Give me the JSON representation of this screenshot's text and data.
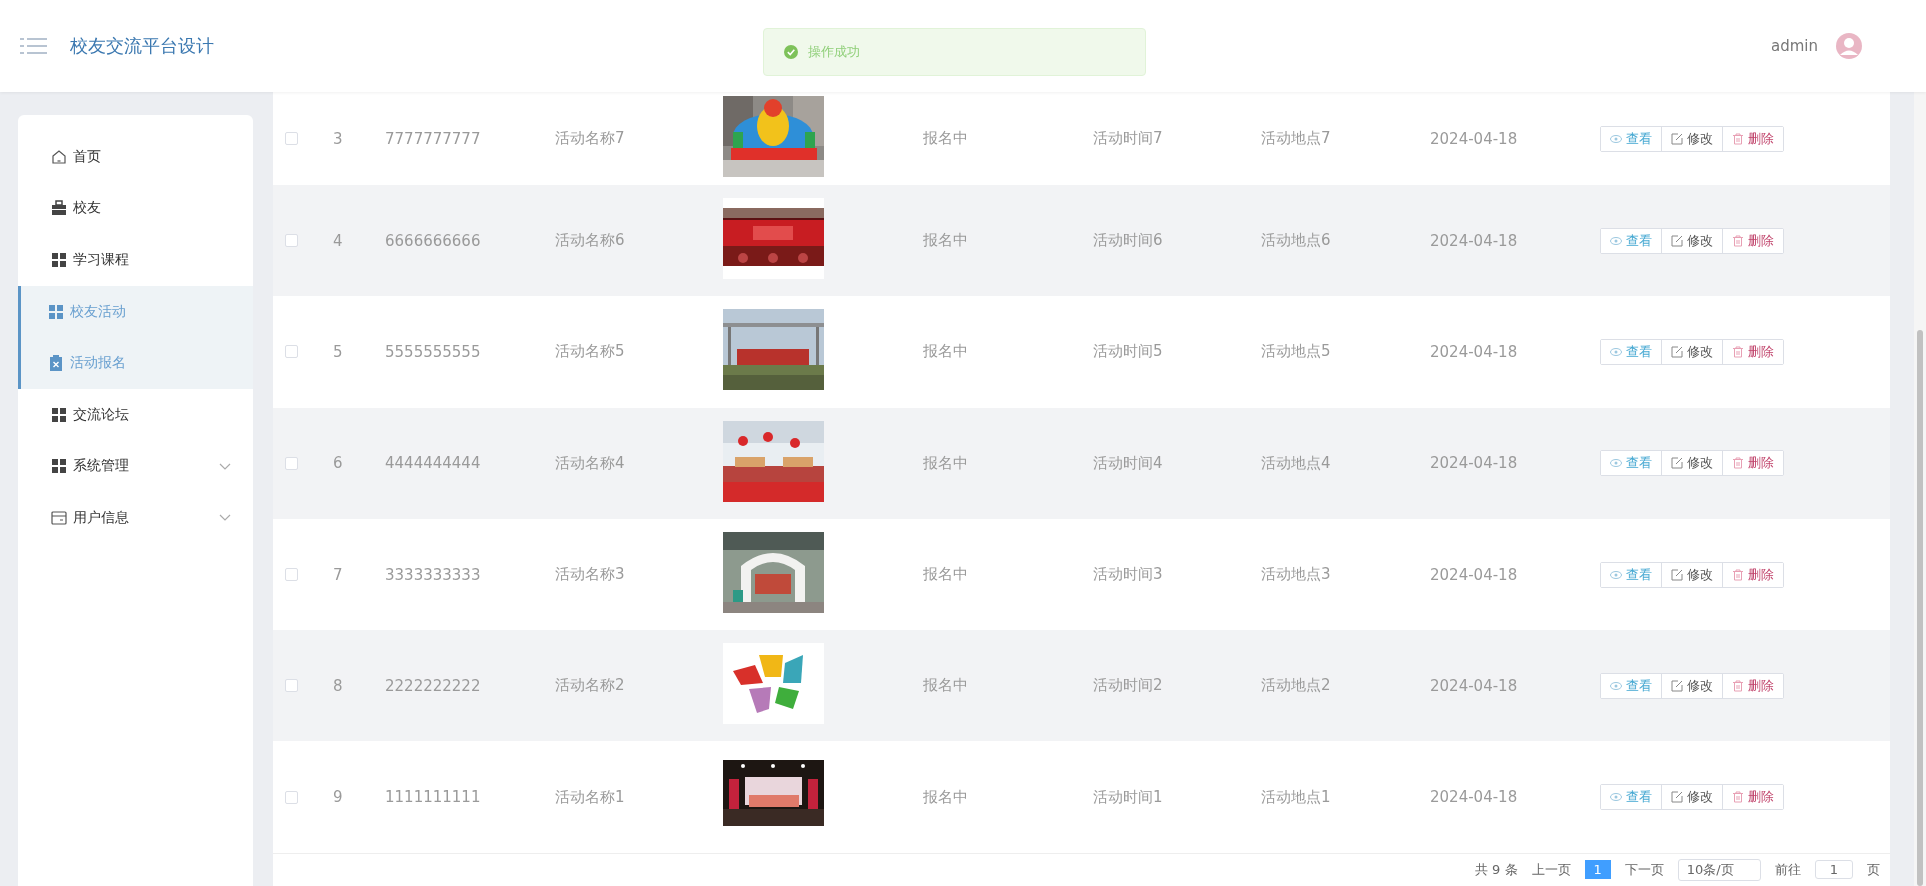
{
  "header": {
    "title": "校友交流平台设计",
    "user": "admin"
  },
  "toast": {
    "message": "操作成功"
  },
  "menu": {
    "items": [
      {
        "label": "首页",
        "selected": false,
        "submenu": false
      },
      {
        "label": "校友",
        "selected": false,
        "submenu": false
      },
      {
        "label": "学习课程",
        "selected": false,
        "submenu": false
      },
      {
        "label": "校友活动",
        "selected": true,
        "submenu": false
      },
      {
        "label": "活动报名",
        "selected": true,
        "submenu": false
      },
      {
        "label": "交流论坛",
        "selected": false,
        "submenu": false
      },
      {
        "label": "系统管理",
        "selected": false,
        "submenu": true
      },
      {
        "label": "用户信息",
        "selected": false,
        "submenu": true
      }
    ]
  },
  "table": {
    "rows": [
      {
        "checked": false,
        "index": "3",
        "number": "7777777777",
        "name": "活动名称7",
        "status": "报名中",
        "time": "活动时间7",
        "location": "活动地点7",
        "date": "2024-04-18",
        "actions": [
          {
            "kind": "view",
            "label": "查看"
          },
          {
            "kind": "edit",
            "label": "修改"
          },
          {
            "kind": "delete",
            "label": "删除"
          }
        ]
      },
      {
        "checked": false,
        "index": "4",
        "number": "6666666666",
        "name": "活动名称6",
        "status": "报名中",
        "time": "活动时间6",
        "location": "活动地点6",
        "date": "2024-04-18",
        "actions": [
          {
            "kind": "view",
            "label": "查看"
          },
          {
            "kind": "edit",
            "label": "修改"
          },
          {
            "kind": "delete",
            "label": "删除"
          }
        ]
      },
      {
        "checked": false,
        "index": "5",
        "number": "5555555555",
        "name": "活动名称5",
        "status": "报名中",
        "time": "活动时间5",
        "location": "活动地点5",
        "date": "2024-04-18",
        "actions": [
          {
            "kind": "view",
            "label": "查看"
          },
          {
            "kind": "edit",
            "label": "修改"
          },
          {
            "kind": "delete",
            "label": "删除"
          }
        ]
      },
      {
        "checked": false,
        "index": "6",
        "number": "4444444444",
        "name": "活动名称4",
        "status": "报名中",
        "time": "活动时间4",
        "location": "活动地点4",
        "date": "2024-04-18",
        "actions": [
          {
            "kind": "view",
            "label": "查看"
          },
          {
            "kind": "edit",
            "label": "修改"
          },
          {
            "kind": "delete",
            "label": "删除"
          }
        ]
      },
      {
        "checked": false,
        "index": "7",
        "number": "3333333333",
        "name": "活动名称3",
        "status": "报名中",
        "time": "活动时间3",
        "location": "活动地点3",
        "date": "2024-04-18",
        "actions": [
          {
            "kind": "view",
            "label": "查看"
          },
          {
            "kind": "edit",
            "label": "修改"
          },
          {
            "kind": "delete",
            "label": "删除"
          }
        ]
      },
      {
        "checked": false,
        "index": "8",
        "number": "2222222222",
        "name": "活动名称2",
        "status": "报名中",
        "time": "活动时间2",
        "location": "活动地点2",
        "date": "2024-04-18",
        "actions": [
          {
            "kind": "view",
            "label": "查看"
          },
          {
            "kind": "edit",
            "label": "修改"
          },
          {
            "kind": "delete",
            "label": "删除"
          }
        ]
      },
      {
        "checked": false,
        "index": "9",
        "number": "1111111111",
        "name": "活动名称1",
        "status": "报名中",
        "time": "活动时间1",
        "location": "活动地点1",
        "date": "2024-04-18",
        "actions": [
          {
            "kind": "view",
            "label": "查看"
          },
          {
            "kind": "edit",
            "label": "修改"
          },
          {
            "kind": "delete",
            "label": "删除"
          }
        ]
      }
    ]
  },
  "pagination": {
    "total": "共 9 条",
    "prev": "上一页",
    "pages": [
      {
        "label": "1",
        "selected": true
      }
    ],
    "next": "下一页",
    "page_size": "10条/页",
    "goto_label": "前往",
    "goto_value": "1",
    "goto_suffix": "页"
  }
}
